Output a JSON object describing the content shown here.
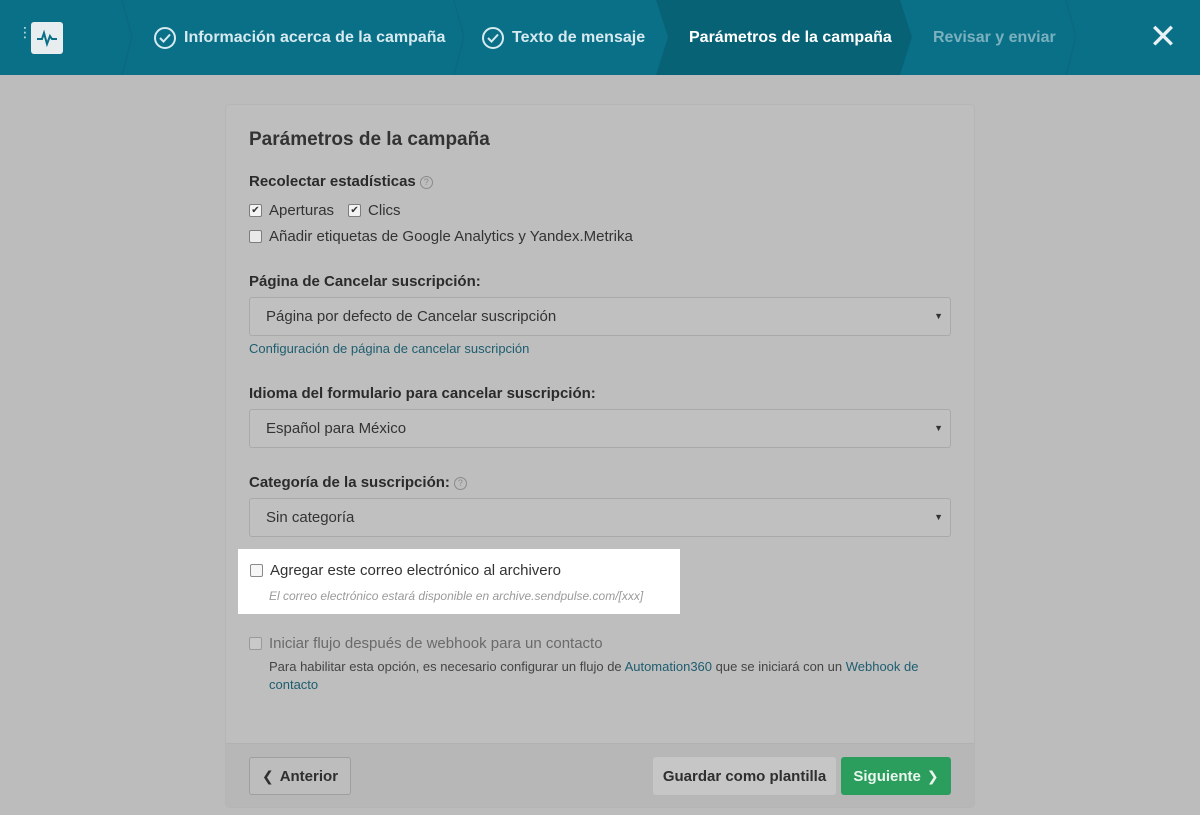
{
  "topbar": {
    "steps": [
      {
        "label": "Información acerca de la campaña",
        "state": "done"
      },
      {
        "label": "Texto de mensaje",
        "state": "done"
      },
      {
        "label": "Parámetros de la campaña",
        "state": "active"
      },
      {
        "label": "Revisar y enviar",
        "state": "upcoming"
      }
    ],
    "close_glyph": "✕",
    "menu_glyph": "⋮",
    "colors": {
      "bar": "#0a7088",
      "active": "#086276"
    }
  },
  "card": {
    "title": "Parámetros de la campaña",
    "stats": {
      "label": "Recolectar estadísticas",
      "opens": {
        "label": "Aperturas",
        "checked": true
      },
      "clicks": {
        "label": "Clics",
        "checked": true
      },
      "utm": {
        "label": "Añadir etiquetas de Google Analytics y Yandex.Metrika",
        "checked": false
      }
    },
    "unsubscribe_page": {
      "label": "Página de Cancelar suscripción:",
      "value": "Página por defecto de Cancelar suscripción",
      "link": "Configuración de página de cancelar suscripción"
    },
    "unsubscribe_lang": {
      "label": "Idioma del formulario para cancelar suscripción:",
      "value": "Español para México"
    },
    "category": {
      "label": "Categoría de la suscripción:",
      "value": "Sin categoría"
    },
    "archive": {
      "label": "Agregar este correo electrónico al archivero",
      "note": "El correo electrónico estará disponible en archive.sendpulse.com/[xxx]",
      "checked": false
    },
    "webhook": {
      "label": "Iniciar flujo después de webhook para un contacto",
      "note_prefix": "Para habilitar esta opción, es necesario configurar un flujo de ",
      "note_link1": "Automation360",
      "note_middle": " que se iniciará con un ",
      "note_link2": "Webhook de contacto",
      "checked": false
    }
  },
  "footer": {
    "prev_label": "Anterior",
    "save_label": "Guardar como plantilla",
    "next_label": "Siguiente"
  }
}
